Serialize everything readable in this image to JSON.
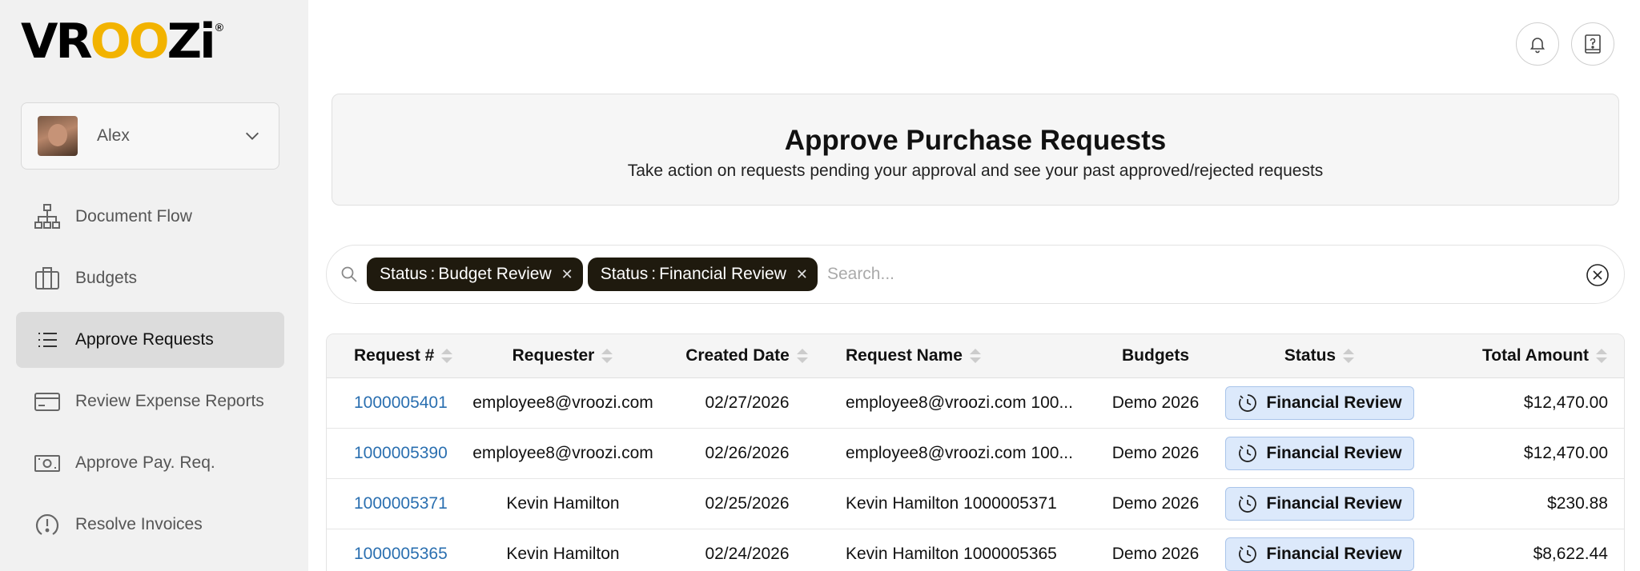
{
  "brand": {
    "logo_pre": "VR",
    "logo_oo": "OO",
    "logo_post": "Zi",
    "reg": "®"
  },
  "user": {
    "name": "Alex"
  },
  "nav": {
    "items": [
      {
        "label": "Document Flow",
        "icon": "sitemap-icon"
      },
      {
        "label": "Budgets",
        "icon": "briefcase-icon"
      },
      {
        "label": "Approve Requests",
        "icon": "list-icon",
        "active": true
      },
      {
        "label": "Review Expense Reports",
        "icon": "credit-card-icon"
      },
      {
        "label": "Approve Pay. Req.",
        "icon": "money-icon"
      },
      {
        "label": "Resolve Invoices",
        "icon": "alert-icon"
      }
    ]
  },
  "header": {
    "notifications_icon": "bell-icon",
    "help_icon": "help-book-icon"
  },
  "page": {
    "title": "Approve Purchase Requests",
    "subtitle": "Take action on requests pending your approval and see your past approved/rejected requests"
  },
  "search": {
    "placeholder": "Search...",
    "filters": [
      {
        "key": "Status",
        "sep": ":",
        "value": "Budget Review"
      },
      {
        "key": "Status",
        "sep": ":",
        "value": "Financial Review"
      }
    ]
  },
  "table": {
    "columns": {
      "request_no": "Request #",
      "requester": "Requester",
      "created_date": "Created Date",
      "request_name": "Request Name",
      "budgets": "Budgets",
      "status": "Status",
      "total_amount": "Total Amount"
    },
    "rows": [
      {
        "request_no": "1000005401",
        "requester": "employee8@vroozi.com",
        "created_date": "02/27/2026",
        "request_name": "employee8@vroozi.com 100...",
        "budgets": "Demo 2026",
        "status": "Financial Review",
        "total_amount": "$12,470.00"
      },
      {
        "request_no": "1000005390",
        "requester": "employee8@vroozi.com",
        "created_date": "02/26/2026",
        "request_name": "employee8@vroozi.com 100...",
        "budgets": "Demo 2026",
        "status": "Financial Review",
        "total_amount": "$12,470.00"
      },
      {
        "request_no": "1000005371",
        "requester": "Kevin Hamilton",
        "created_date": "02/25/2026",
        "request_name": "Kevin Hamilton 1000005371",
        "budgets": "Demo 2026",
        "status": "Financial Review",
        "total_amount": "$230.88"
      },
      {
        "request_no": "1000005365",
        "requester": "Kevin Hamilton",
        "created_date": "02/24/2026",
        "request_name": "Kevin Hamilton 1000005365",
        "budgets": "Demo 2026",
        "status": "Financial Review",
        "total_amount": "$8,622.44"
      }
    ]
  },
  "colors": {
    "accent_logo": "#f2b300",
    "link": "#2a6fb0",
    "chip_bg": "#1f1a0e",
    "status_bg": "#dce9fb"
  }
}
